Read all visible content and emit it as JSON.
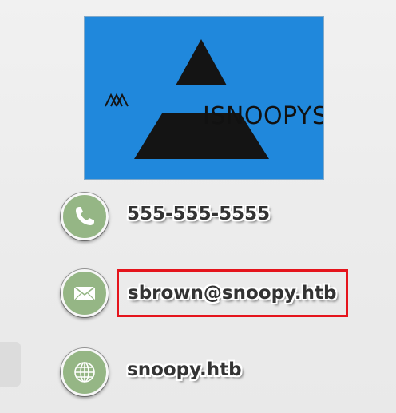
{
  "logo": {
    "text": "ISNOOPYSEC",
    "background_color": "#2088dc"
  },
  "contacts": {
    "phone": {
      "icon": "phone-icon",
      "value": "555-555-5555"
    },
    "email": {
      "icon": "envelope-icon",
      "value": "sbrown@snoopy.htb",
      "highlight_color": "#e5141c"
    },
    "website": {
      "icon": "globe-icon",
      "value": "snoopy.htb"
    }
  },
  "colors": {
    "icon_circle": "#95b685",
    "text": "#333333"
  }
}
